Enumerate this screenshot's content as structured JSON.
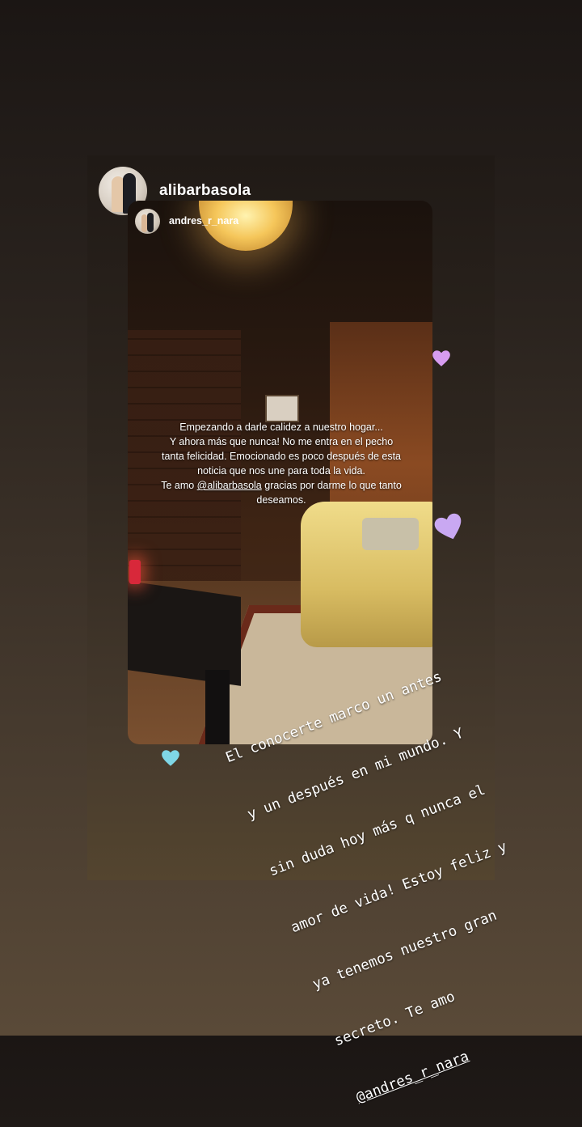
{
  "story": {
    "poster": {
      "username": "alibarbasola",
      "avatar_icon": "profile-photo-couple-icon"
    },
    "reshared_post": {
      "username": "andres_r_nara",
      "avatar_icon": "profile-photo-couple-icon",
      "caption_lines": [
        "Empezando a darle calidez a nuestro hogar...",
        "Y ahora más que nunca! No me entra en el pecho",
        "tanta felicidad. Emocionado es poco después de esta",
        "noticia que nos une para toda la vida."
      ],
      "caption_line5_prefix": "Te amo ",
      "caption_mention": "@alibarbasola",
      "caption_line5_suffix": " gracias por darme lo que tanto",
      "caption_line6": "deseamos."
    },
    "overlay_text": {
      "lines": [
        "El conocerte marco un antes",
        "y un después en mi mundo. Y",
        "sin duda hoy más q nunca el",
        "amor de vida! Estoy feliz y",
        "ya tenemos nuestro gran",
        "secreto. Te amo"
      ],
      "mention": "@andres_r_nara"
    },
    "stickers": {
      "heart_colors": [
        "#d79cf0",
        "#c9a8f2",
        "#7fd6e6"
      ],
      "heart_icon": "heart-sticker-icon"
    }
  }
}
